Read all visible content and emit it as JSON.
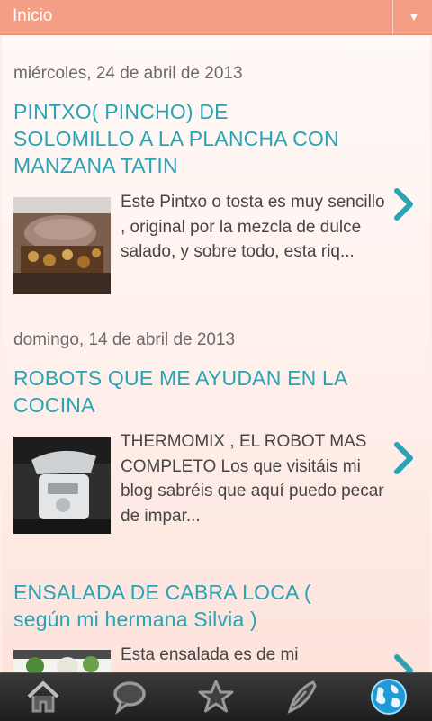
{
  "header": {
    "title": "Inicio",
    "menu_icon": "dropdown-arrow-icon"
  },
  "posts": [
    {
      "date": "miércoles, 24 de abril de 2013",
      "title": "PINTXO( PINCHO) DE SOLOMILLO A LA PLANCHA CON MANZANA TATIN",
      "excerpt": "Este Pintxo o tosta es muy sencillo , original por la mezcla de dulce salado, y sobre todo, esta riq...",
      "thumbnail": "pintxo-photo"
    },
    {
      "date": "domingo, 14 de abril de 2013",
      "title": "ROBOTS QUE ME AYUDAN EN LA COCINA",
      "excerpt": "THERMOMIX , EL ROBOT MAS COMPLETO Los que visitáis mi blog  sabréis que aquí puedo pecar de impar...",
      "thumbnail": "thermomix-photo"
    },
    {
      "date": "",
      "title": "ENSALADA DE CABRA LOCA ( según mi hermana Silvia )",
      "excerpt": "Esta ensalada es de mi",
      "thumbnail": "salad-photo"
    }
  ],
  "bottom_nav": [
    {
      "icon": "home-icon"
    },
    {
      "icon": "comments-icon"
    },
    {
      "icon": "star-icon"
    },
    {
      "icon": "edit-icon"
    },
    {
      "icon": "globe-icon",
      "active": true
    }
  ],
  "colors": {
    "header": "#f49e86",
    "title": "#2aa3b4",
    "accent": "#2aa3b4"
  }
}
